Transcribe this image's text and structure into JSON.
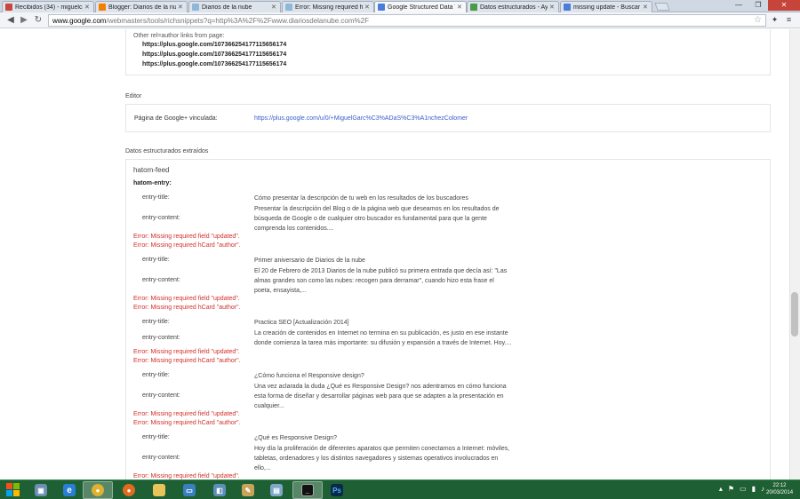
{
  "browser": {
    "tabs": [
      {
        "label": "Recibidos (34) - miguelcar",
        "favicon_color": "#c9463d",
        "favicon": "gmail-icon"
      },
      {
        "label": "Blogger: Diarios de la nub",
        "favicon_color": "#f57d00",
        "favicon": "blogger-icon"
      },
      {
        "label": "Diarios de la nube",
        "favicon_color": "#8fb8d8",
        "favicon": "cloud-icon"
      },
      {
        "label": "Error: Missing required fie",
        "favicon_color": "#8fb8d8",
        "favicon": "cloud-icon"
      },
      {
        "label": "Google Structured Data Te",
        "favicon_color": "#4a7cdc",
        "favicon": "google-icon"
      },
      {
        "label": "Datos estructurados - Ayu",
        "favicon_color": "#4a9a4a",
        "favicon": "google-docs-icon"
      },
      {
        "label": "missing update - Buscar c",
        "favicon_color": "#4a7cdc",
        "favicon": "google-icon"
      }
    ],
    "url_domain": "www.google.com",
    "url_path": "/webmasters/tools/richsnippets?q=http%3A%2F%2Fwww.diariosdelanube.com%2F"
  },
  "author_section": {
    "heading": "Other rel=author links from page:",
    "links": [
      "https://plus.google.com/107366254177115656174",
      "https://plus.google.com/107366254177115656174",
      "https://plus.google.com/107366254177115656174"
    ]
  },
  "editor_section": {
    "heading": "Editor",
    "label": "Página de Google+ vinculada:",
    "link": "https://plus.google.com/u/0/+MiguelGarc%C3%ADaS%C3%A1nchezColomer"
  },
  "extracted_section": {
    "heading": "Datos estructurados extraídos",
    "feed": "hatom-feed",
    "entry_heading": "hatom-entry:",
    "title_label": "entry-title:",
    "content_label": "entry-content:",
    "entries": [
      {
        "title": "Cómo presentar la descripción de tu web en los resultados de los buscadores",
        "content": "Presentar la descripción del Blog o de la página web que deseamos en los resultados de búsqueda de Google o de cualquier otro buscador es fundamental para que la gente comprenda los contenidos....",
        "err1": "Error: Missing required field \"updated\".",
        "err2": "Error: Missing required hCard \"author\"."
      },
      {
        "title": "Primer aniversario de Diarios de la nube",
        "content": "El 20 de Febrero de 2013 Diarios de la nube publicó su primera entrada que decía así: \"Las almas grandes son como las nubes: recogen para derramar\", cuando hizo esta frase el poeta, ensayista,...",
        "err1": "Error: Missing required field \"updated\".",
        "err2": "Error: Missing required hCard \"author\"."
      },
      {
        "title": "Practica SEO [Actualización 2014]",
        "content": "La creación de contenidos en Internet no termina en su publicación, es justo en ese instante donde comienza la tarea más importante: su difusión y expansión a través de Internet. Hoy....",
        "err1": "Error: Missing required field \"updated\".",
        "err2": "Error: Missing required hCard \"author\"."
      },
      {
        "title": "¿Cómo funciona el Responsive design?",
        "content": "Una vez aclarada la duda ¿Qué es Responsive Design? nos adentramos en cómo funciona esta forma de diseñar y desarrollar páginas web para que se adapten a la presentación en cualquier...",
        "err1": "Error: Missing required field \"updated\".",
        "err2": "Error: Missing required hCard \"author\"."
      },
      {
        "title": "¿Qué es Responsive Design?",
        "content": "Hoy día la proliferación de diferentes aparatos que permiten conectarnos a Internet: móviles, tabletas, ordenadores y los distintos navegadores y sistemas operativos involucrados en ello,...",
        "err1": "Error: Missing required field \"updated\".",
        "err2": ""
      }
    ]
  },
  "taskbar": {
    "time": "22:12",
    "date": "20/03/2014",
    "apps": [
      "explorer-icon",
      "ie-icon",
      "chrome-icon",
      "firefox-icon",
      "folder-icon",
      "remote-desktop-icon",
      "network-icon",
      "paint-icon",
      "notes-icon",
      "cmd-icon",
      "photoshop-icon"
    ]
  }
}
